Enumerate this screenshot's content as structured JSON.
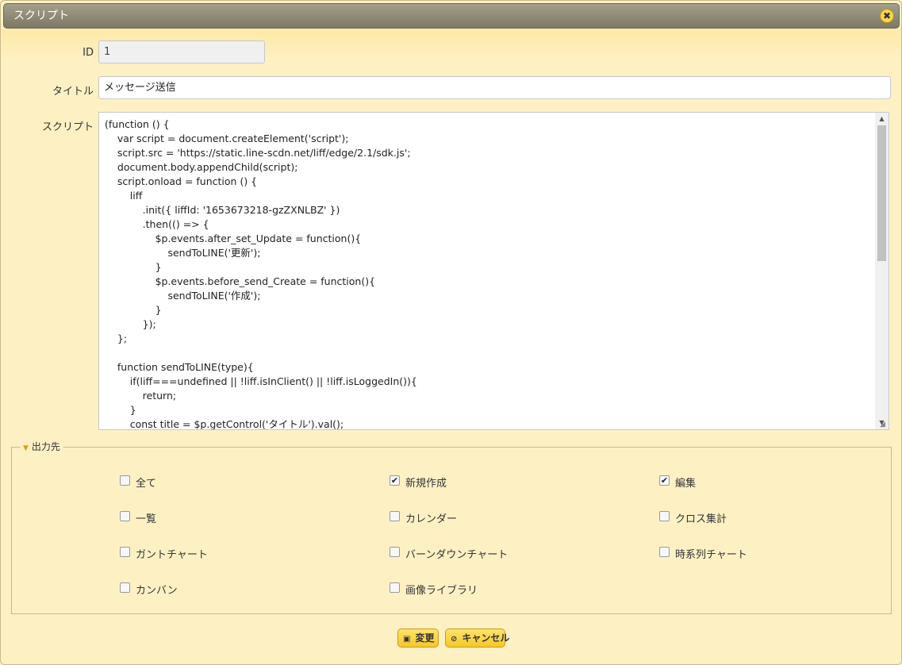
{
  "dialog": {
    "title": "スクリプト",
    "close_icon": "✖"
  },
  "form": {
    "id_label": "ID",
    "id_value": "1",
    "title_label": "タイトル",
    "title_value": "メッセージ送信",
    "script_label": "スクリプト",
    "script_lines": [
      "(function () {",
      "    var script = document.createElement('script');",
      "    script.src = 'https://static.line-scdn.net/liff/edge/2.1/sdk.js';",
      "    document.body.appendChild(script);",
      "    script.onload = function () {",
      "        liff",
      "            .init({ liffId: '1653673218-gzZXNLBZ' })",
      "            .then(() => {",
      "                $p.events.after_set_Update = function(){",
      "                    sendToLINE('更新');",
      "                }",
      "                $p.events.before_send_Create = function(){",
      "                    sendToLINE('作成');",
      "                }",
      "            });",
      "    };",
      "",
      "    function sendToLINE(type){",
      "        if(liff===undefined || !liff.isInClient() || !liff.isLoggedIn()){",
      "            return;",
      "        }",
      "        const title = $p.getControl('タイトル').val();"
    ]
  },
  "output": {
    "legend": "出力先",
    "items": [
      {
        "label": "全て",
        "checked": false
      },
      {
        "label": "新規作成",
        "checked": true
      },
      {
        "label": "編集",
        "checked": true
      },
      {
        "label": "一覧",
        "checked": false
      },
      {
        "label": "カレンダー",
        "checked": false
      },
      {
        "label": "クロス集計",
        "checked": false
      },
      {
        "label": "ガントチャート",
        "checked": false
      },
      {
        "label": "バーンダウンチャート",
        "checked": false
      },
      {
        "label": "時系列チャート",
        "checked": false
      },
      {
        "label": "カンバン",
        "checked": false
      },
      {
        "label": "画像ライブラリ",
        "checked": false
      }
    ]
  },
  "buttons": {
    "save_label": "変更",
    "cancel_label": "キャンセル"
  },
  "icons": {
    "save_icon": "floppy-disk-icon",
    "cancel_icon": "cancel-circle-icon"
  },
  "colors": {
    "background": "#fdf1c4",
    "accent": "#f5c72a",
    "titlebar": "#7d7863"
  }
}
